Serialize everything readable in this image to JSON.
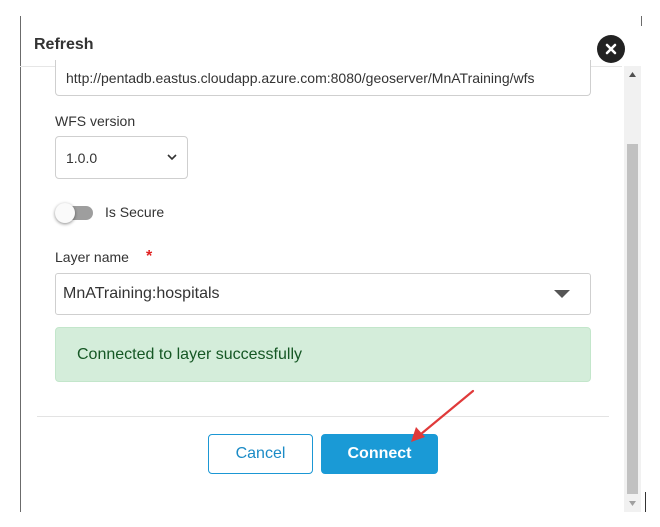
{
  "dialog": {
    "title": "Refresh"
  },
  "form": {
    "url_value": "http://pentadb.eastus.cloudapp.azure.com:8080/geoserver/MnATraining/wfs",
    "wfs_version_label": "WFS version",
    "wfs_version_value": "1.0.0",
    "is_secure_label": "Is Secure",
    "is_secure_on": false,
    "layer_name_label": "Layer name",
    "required_marker": "*",
    "layer_name_value": "MnATraining:hospitals"
  },
  "alert": {
    "message": "Connected to layer successfully",
    "status_color": "#d4edda"
  },
  "footer": {
    "cancel_label": "Cancel",
    "connect_label": "Connect"
  },
  "icons": {
    "close": "close-icon",
    "dropdown": "chevron-down-icon",
    "caret": "caret-down-icon",
    "annotation": "red-arrow-annotation"
  },
  "colors": {
    "accent": "#1a9ad6",
    "required": "#e02020",
    "annotation": "#e03a3a"
  }
}
